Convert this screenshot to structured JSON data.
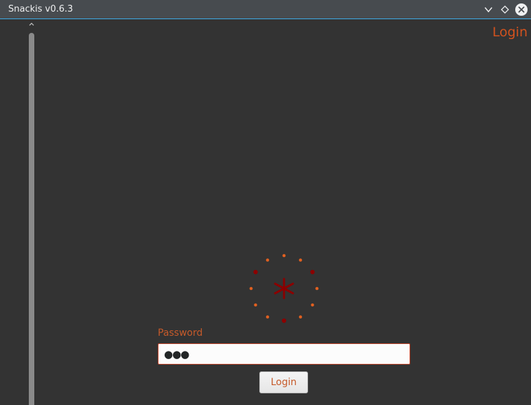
{
  "window": {
    "title": "Snackis v0.6.3"
  },
  "heading": "Login",
  "form": {
    "password_label": "Password",
    "password_value": "●●●",
    "login_label": "Login"
  },
  "colors": {
    "accent": "#d2521e",
    "titlebar": "#474b4f",
    "background": "#333333",
    "logo_dark": "#8b0000",
    "logo_light": "#e06020"
  },
  "icons": {
    "minimize": "chevron-down-icon",
    "maximize": "diamond-icon",
    "close": "close-icon",
    "logo": "snackis-logo-icon"
  }
}
